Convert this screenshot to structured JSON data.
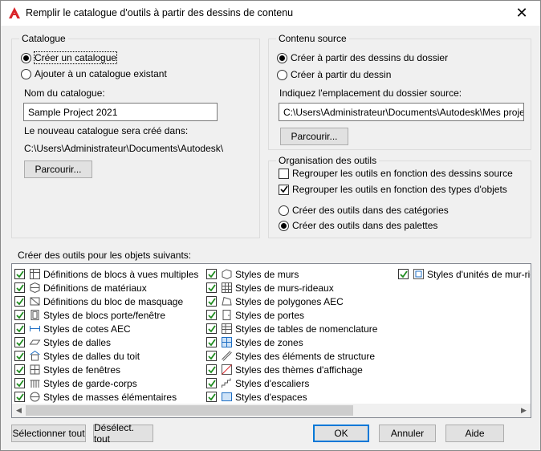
{
  "window": {
    "title": "Remplir le catalogue d'outils à partir des dessins de contenu",
    "close_glyph": "✕"
  },
  "catalogue": {
    "group_label": "Catalogue",
    "create_label": "Créer un catalogue",
    "add_existing_label": "Ajouter à un catalogue existant",
    "selected": "create",
    "name_label": "Nom du catalogue:",
    "name_value": "Sample Project 2021",
    "created_in_label": "Le nouveau catalogue sera créé dans:",
    "created_in_path": "C:\\Users\\Administrateur\\Documents\\Autodesk\\",
    "browse_label": "Parcourir..."
  },
  "source": {
    "group_label": "Contenu source",
    "folder_label": "Créer à partir des dessins du dossier",
    "drawing_label": "Créer à partir du dessin",
    "selected": "folder",
    "location_label": "Indiquez l'emplacement du dossier source:",
    "location_value": "C:\\Users\\Administrateur\\Documents\\Autodesk\\Mes projets\\Sa",
    "browse_label": "Parcourir..."
  },
  "organisation": {
    "group_label": "Organisation des outils",
    "by_drawing_label": "Regrouper les outils en fonction des dessins source",
    "by_drawing_checked": false,
    "by_type_label": "Regrouper les outils en fonction des types d'objets",
    "by_type_checked": true,
    "in_categories_label": "Créer des outils dans des catégories",
    "in_palettes_label": "Créer des outils dans des palettes",
    "selected": "palettes"
  },
  "objects": {
    "label": "Créer des outils pour les objets suivants:",
    "col1": [
      {
        "label": "Définitions de blocs à vues multiples",
        "icon": "mvblock-icon",
        "checked": true
      },
      {
        "label": "Définitions de matériaux",
        "icon": "material-icon",
        "checked": true
      },
      {
        "label": "Définitions du bloc de masquage",
        "icon": "mask-block-icon",
        "checked": true
      },
      {
        "label": "Styles de blocs porte/fenêtre",
        "icon": "door-window-block-icon",
        "checked": true
      },
      {
        "label": "Styles de cotes AEC",
        "icon": "dimension-icon",
        "checked": true
      },
      {
        "label": "Styles de dalles",
        "icon": "slab-icon",
        "checked": true
      },
      {
        "label": "Styles de dalles du toit",
        "icon": "roof-slab-icon",
        "checked": true
      },
      {
        "label": "Styles de fenêtres",
        "icon": "window-icon",
        "checked": true
      },
      {
        "label": "Styles de garde-corps",
        "icon": "railing-icon",
        "checked": true
      },
      {
        "label": "Styles de masses élémentaires",
        "icon": "mass-element-icon",
        "checked": true
      }
    ],
    "col2": [
      {
        "label": "Styles de murs",
        "icon": "wall-icon",
        "checked": true
      },
      {
        "label": "Styles de murs-rideaux",
        "icon": "curtain-wall-icon",
        "checked": true
      },
      {
        "label": "Styles de polygones AEC",
        "icon": "polygon-icon",
        "checked": true
      },
      {
        "label": "Styles de portes",
        "icon": "door-icon",
        "checked": true
      },
      {
        "label": "Styles de tables de nomenclature",
        "icon": "schedule-table-icon",
        "checked": true
      },
      {
        "label": "Styles de zones",
        "icon": "zone-icon",
        "checked": true
      },
      {
        "label": "Styles des éléments de structure",
        "icon": "structural-member-icon",
        "checked": true
      },
      {
        "label": "Styles des thèmes d'affichage",
        "icon": "display-theme-icon",
        "checked": true
      },
      {
        "label": "Styles d'escaliers",
        "icon": "stair-icon",
        "checked": true
      },
      {
        "label": "Styles d'espaces",
        "icon": "space-icon",
        "checked": true
      }
    ],
    "col3": [
      {
        "label": "Styles d'unités de mur-rideau",
        "icon": "curtain-wall-unit-icon",
        "checked": true
      }
    ]
  },
  "footer": {
    "select_all": "Sélectionner tout",
    "deselect_all": "Désélect. tout",
    "ok": "OK",
    "cancel": "Annuler",
    "help": "Aide"
  },
  "colors": {
    "accent": "#0078d7",
    "check_green": "#1e8c1e",
    "app_red": "#d9252a"
  }
}
